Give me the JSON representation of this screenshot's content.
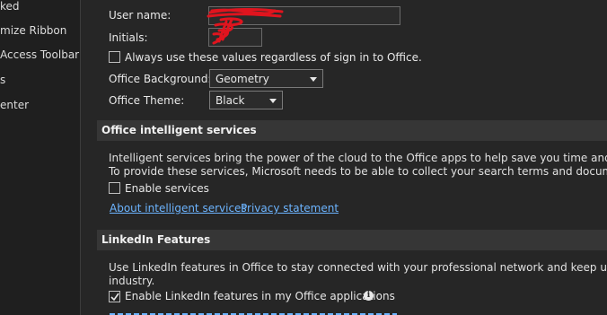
{
  "sidebar": {
    "items": [
      {
        "label": "ked"
      },
      {
        "label": "mize Ribbon"
      },
      {
        "label": "Access Toolbar"
      },
      {
        "label": "s"
      },
      {
        "label": "enter"
      }
    ]
  },
  "personalize": {
    "username_label": "User name:",
    "username_value": "",
    "initials_label": "Initials:",
    "initials_value": "",
    "always_use_label": "Always use these values regardless of sign in to Office.",
    "always_use_checked": false,
    "background_label": "Office Background:",
    "background_value": "Geometry",
    "theme_label": "Office Theme:",
    "theme_value": "Black"
  },
  "intelligent_services": {
    "header": "Office intelligent services",
    "line1": "Intelligent services bring the power of the cloud to the Office apps to help save you time and produce bet",
    "line2": "To provide these services, Microsoft needs to be able to collect your search terms and document content.",
    "enable_label": "Enable services",
    "enable_checked": false,
    "about_link": "About intelligent services",
    "privacy_link": "Privacy statement"
  },
  "linkedin": {
    "header": "LinkedIn Features",
    "line1": "Use LinkedIn features in Office to stay connected with your professional network and keep up to date in you",
    "line2": "industry.",
    "enable_label": "Enable LinkedIn features in my Office applications",
    "enable_checked": true,
    "info_icon": "info-icon"
  },
  "colors": {
    "background": "#262626",
    "section_header": "#363636",
    "link": "#6cb4ff",
    "redaction": "#e0141e"
  }
}
